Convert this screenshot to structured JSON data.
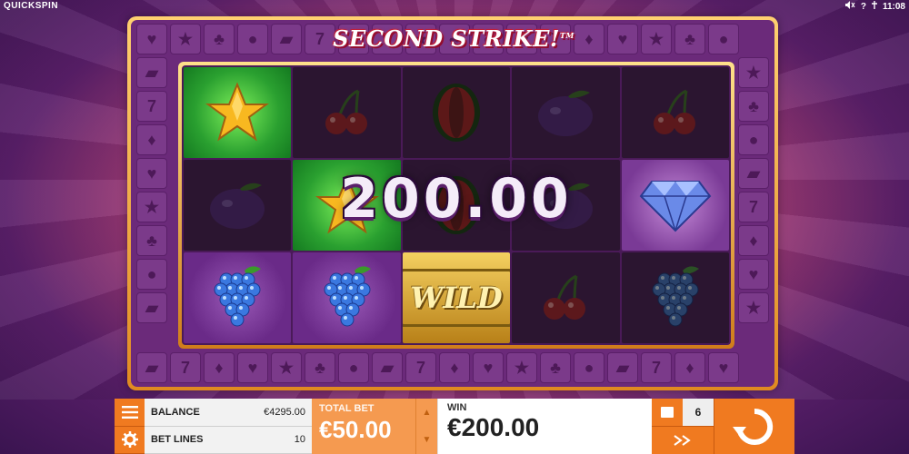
{
  "brand": "QUICKSPIN",
  "status": {
    "time": "11:08",
    "help": "?"
  },
  "game": {
    "title": "SECOND STRIKE!",
    "trademark": "TM",
    "win_overlay": "200.00",
    "wild_label": "WILD"
  },
  "grid": [
    [
      "star",
      "cherry",
      "melon",
      "plum",
      "cherry"
    ],
    [
      "plum",
      "star",
      "melon",
      "plum",
      "diamond"
    ],
    [
      "grapes",
      "grapes",
      "wild",
      "cherry",
      "grapes"
    ]
  ],
  "highlighted": [
    [
      0,
      0
    ],
    [
      1,
      1
    ],
    [
      2,
      0
    ],
    [
      2,
      1
    ],
    [
      2,
      2
    ],
    [
      1,
      4
    ]
  ],
  "controls": {
    "balance_label": "BALANCE",
    "balance_value": "€4295.00",
    "bet_lines_label": "BET LINES",
    "bet_lines_value": "10",
    "total_bet_label": "TOTAL BET",
    "total_bet_value": "€50.00",
    "win_label": "WIN",
    "win_value": "€200.00",
    "autoplay_count": "6"
  },
  "colors": {
    "accent": "#f07a20",
    "frame_gold": "#e08a20",
    "reel_bg": "#4a1a58"
  }
}
